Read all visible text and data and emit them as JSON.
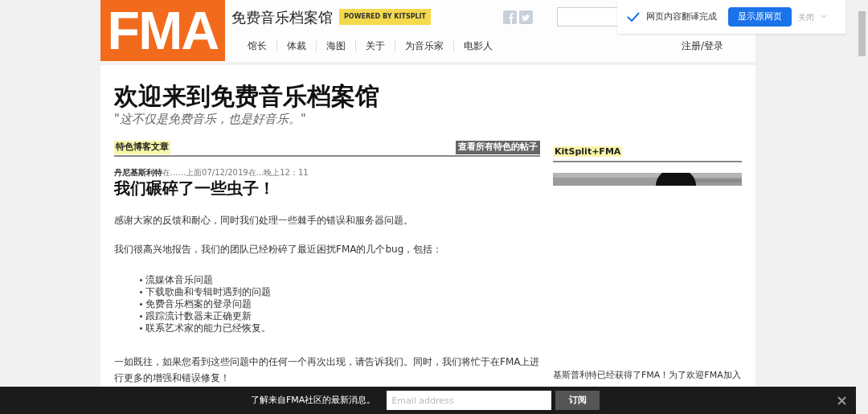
{
  "header": {
    "logo": "FMA",
    "site_name": "免费音乐档案馆",
    "badge": "POWERED BY KITSPLIT",
    "nav": [
      "馆长",
      "体裁",
      "海图",
      "关于",
      "为音乐家",
      "电影人"
    ],
    "login": "注册/登录"
  },
  "translate_bar": {
    "message": "网页内容翻译完成",
    "show_original": "显示原网页",
    "close": "关闭"
  },
  "page": {
    "heading": "欢迎来到免费音乐档案馆",
    "tagline": "\"这不仅是免费音乐，也是好音乐。\""
  },
  "featured": {
    "label": "特色博客文章",
    "view_all": "查看所有特色的帖子"
  },
  "post": {
    "author": "丹尼基斯利特",
    "meta": "在......上面07/12/2019在...晚上12：11",
    "title": "我们碾碎了一些虫子！",
    "intro": [
      "感谢大家的反馈和耐心，同时我们处理一些棘手的错误和服务器问题。",
      "我们很高兴地报告，我们的团队已经粉碎了最近困扰FMA的几个bug，包括："
    ],
    "bullets": [
      "流媒体音乐问题",
      "下载歌曲和专辑时遇到的问题",
      "免费音乐档案的登录问题",
      "跟踪流计数器未正确更新",
      "联系艺术家的能力已经恢复。"
    ],
    "outro": [
      "一如既往，如果您看到这些问题中的任何一个再次出现，请告诉我们。同时，我们将忙于在FMA上进行更多的增强和错误修复！"
    ]
  },
  "sidebar": {
    "heading": "KitSplit+FMA",
    "text": "基斯普利特已经获得了FMA！为了欢迎FMA加入"
  },
  "newsletter": {
    "message": "了解来自FMA社区的最新消息。",
    "email_placeholder": "Email address",
    "subscribe": "订阅"
  }
}
